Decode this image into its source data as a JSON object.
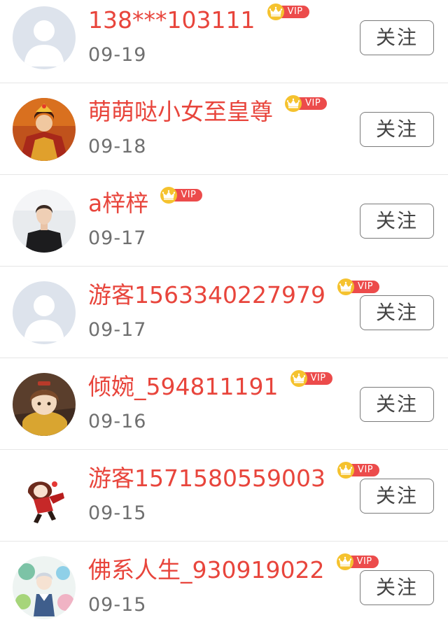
{
  "follow_label": "关注",
  "vip_label": "VIP",
  "colors": {
    "username": "#e8453c",
    "vip_pill": "#ec4b4b",
    "crown_circle": "#f5c22e",
    "date": "#6f6f6f",
    "divider": "#e6e6e6"
  },
  "users": [
    {
      "name": "138***103111",
      "date": "09-19",
      "avatar": "default-avatar"
    },
    {
      "name": "萌萌哒小女至皇尊",
      "date": "09-18",
      "avatar": "empress-avatar"
    },
    {
      "name": "a梓梓",
      "date": "09-17",
      "avatar": "young-man-avatar"
    },
    {
      "name": "游客1563340227979",
      "date": "09-17",
      "avatar": "default-avatar"
    },
    {
      "name": "倾婉_594811191",
      "date": "09-16",
      "avatar": "anime-girl-avatar"
    },
    {
      "name": "游客1571580559003",
      "date": "09-15",
      "avatar": "chibi-avatar"
    },
    {
      "name": "佛系人生_930919022",
      "date": "09-15",
      "avatar": "illustration-avatar"
    }
  ]
}
